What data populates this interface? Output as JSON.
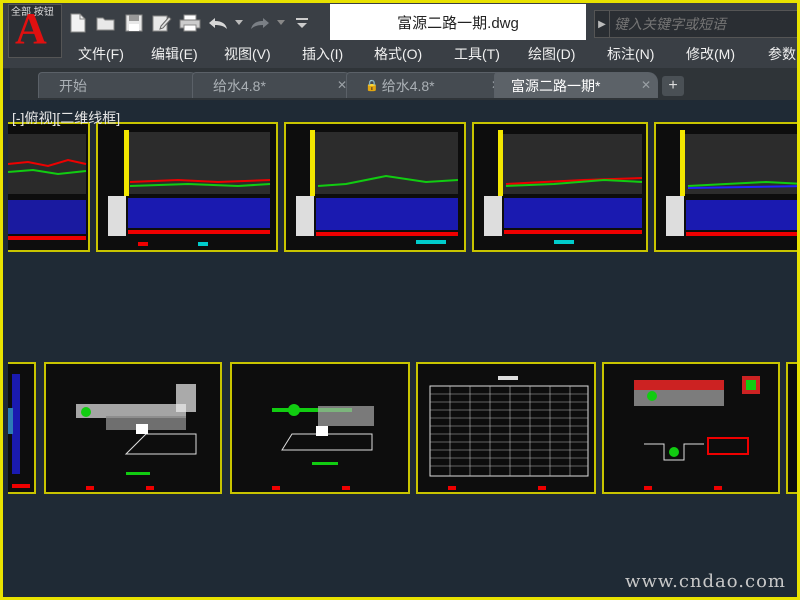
{
  "app": {
    "logo_letter": "A",
    "logo_caption": "全部 按钮",
    "document_title": "富源二路一期.dwg"
  },
  "quick_access": [
    "new-icon",
    "open-icon",
    "save-icon",
    "saveas-icon",
    "plot-icon",
    "undo-icon",
    "redo-icon",
    "dropdown-icon"
  ],
  "search": {
    "placeholder": "键入关键字或短语"
  },
  "menu": [
    "文件(F)",
    "编辑(E)",
    "视图(V)",
    "插入(I)",
    "格式(O)",
    "工具(T)",
    "绘图(D)",
    "标注(N)",
    "修改(M)",
    "参数"
  ],
  "tabs": [
    {
      "label": "开始",
      "active": false,
      "closable": false
    },
    {
      "label": "给水4.8*",
      "active": false,
      "closable": true
    },
    {
      "label": "给水4.8*",
      "active": false,
      "closable": true,
      "locked": true
    },
    {
      "label": "富源二路一期*",
      "active": true,
      "closable": true
    }
  ],
  "viewport": {
    "label": "[-]俯视][二维线框]"
  },
  "watermark": "www.cndao.com",
  "colors": {
    "accent": "#e8e200",
    "sheet_bg": "#0d0d0d",
    "canvas_bg": "#1f2a35"
  }
}
